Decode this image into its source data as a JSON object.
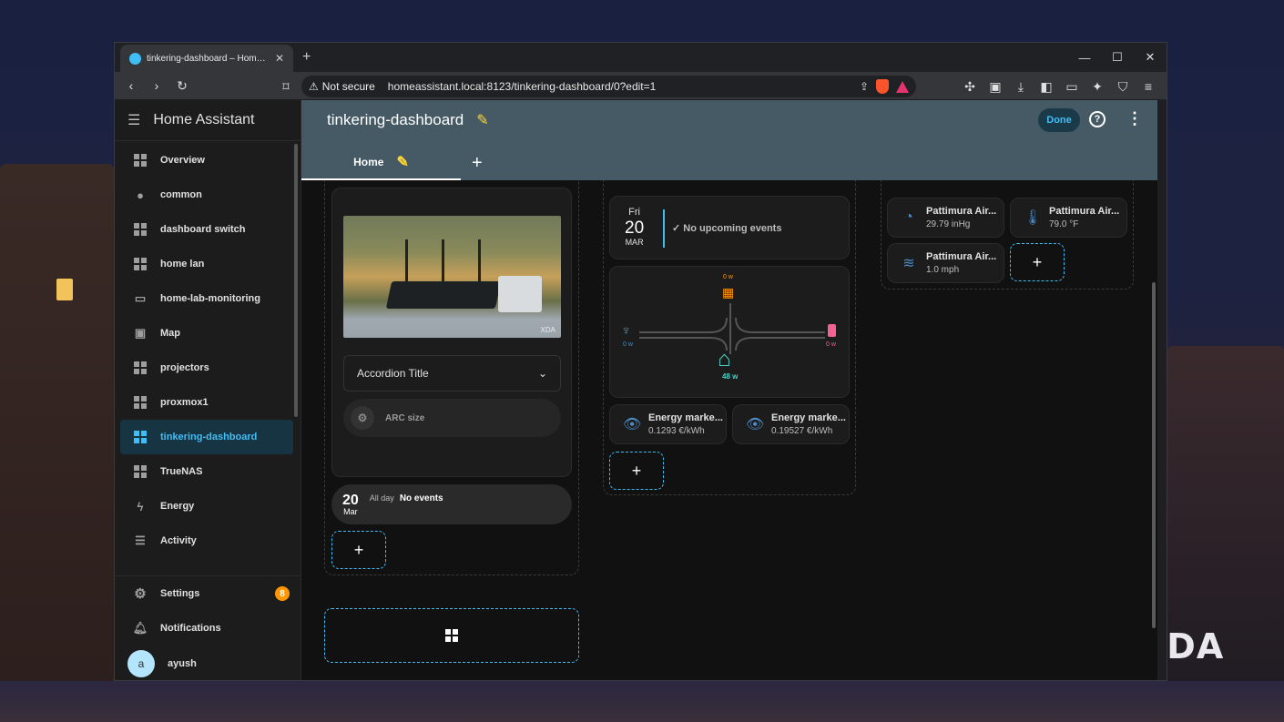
{
  "browser": {
    "tab_title": "tinkering-dashboard – Home Assistant",
    "security_label": "Not secure",
    "url": "homeassistant.local:8123/tinkering-dashboard/0?edit=1"
  },
  "sidebar": {
    "title": "Home Assistant",
    "items": [
      {
        "label": "Overview",
        "icon": "grid-icon"
      },
      {
        "label": "common",
        "icon": "person-icon"
      },
      {
        "label": "dashboard switch",
        "icon": "grid-icon"
      },
      {
        "label": "home lan",
        "icon": "grid-icon"
      },
      {
        "label": "home-lab-monitoring",
        "icon": "monitor-icon"
      },
      {
        "label": "Map",
        "icon": "map-icon"
      },
      {
        "label": "projectors",
        "icon": "grid-icon"
      },
      {
        "label": "proxmox1",
        "icon": "grid-icon"
      },
      {
        "label": "tinkering-dashboard",
        "icon": "grid-icon"
      },
      {
        "label": "TrueNAS",
        "icon": "grid-icon"
      },
      {
        "label": "Energy",
        "icon": "lightning-icon"
      },
      {
        "label": "Activity",
        "icon": "list-icon"
      }
    ],
    "settings_label": "Settings",
    "settings_badge": "8",
    "notifications_label": "Notifications",
    "user_initial": "a",
    "user_name": "ayush"
  },
  "header": {
    "title": "tinkering-dashboard",
    "done_label": "Done",
    "view_tab": "Home"
  },
  "col1": {
    "photo_watermark": "XDA",
    "accordion_title": "Accordion Title",
    "arc_label": "ARC size",
    "calendar": {
      "day": "20",
      "month": "Mar",
      "all_day": "All day",
      "event": "No events"
    }
  },
  "col2": {
    "calendar": {
      "weekday": "Fri",
      "day": "20",
      "month": "MAR",
      "event": "No upcoming events"
    },
    "energy": {
      "solar": "0 w",
      "grid": "0 w",
      "battery": "0 w",
      "home": "48 w"
    },
    "sensors": [
      {
        "name": "Energy marke...",
        "value": "0.1293 €/kWh"
      },
      {
        "name": "Energy marke...",
        "value": "0.19527 €/kWh"
      }
    ]
  },
  "col3": {
    "sensors": [
      {
        "name": "Pattimura Air...",
        "value": "29.79 inHg",
        "icon": "gauge-icon"
      },
      {
        "name": "Pattimura Air...",
        "value": "79.0 °F",
        "icon": "thermometer-icon"
      },
      {
        "name": "Pattimura Air...",
        "value": "1.0 mph",
        "icon": "wind-icon"
      }
    ]
  },
  "watermark": "XDA",
  "colors": {
    "accent": "#41bdf5",
    "header": "#455a64",
    "badge": "#ff9800",
    "pencil": "#fdd835"
  }
}
